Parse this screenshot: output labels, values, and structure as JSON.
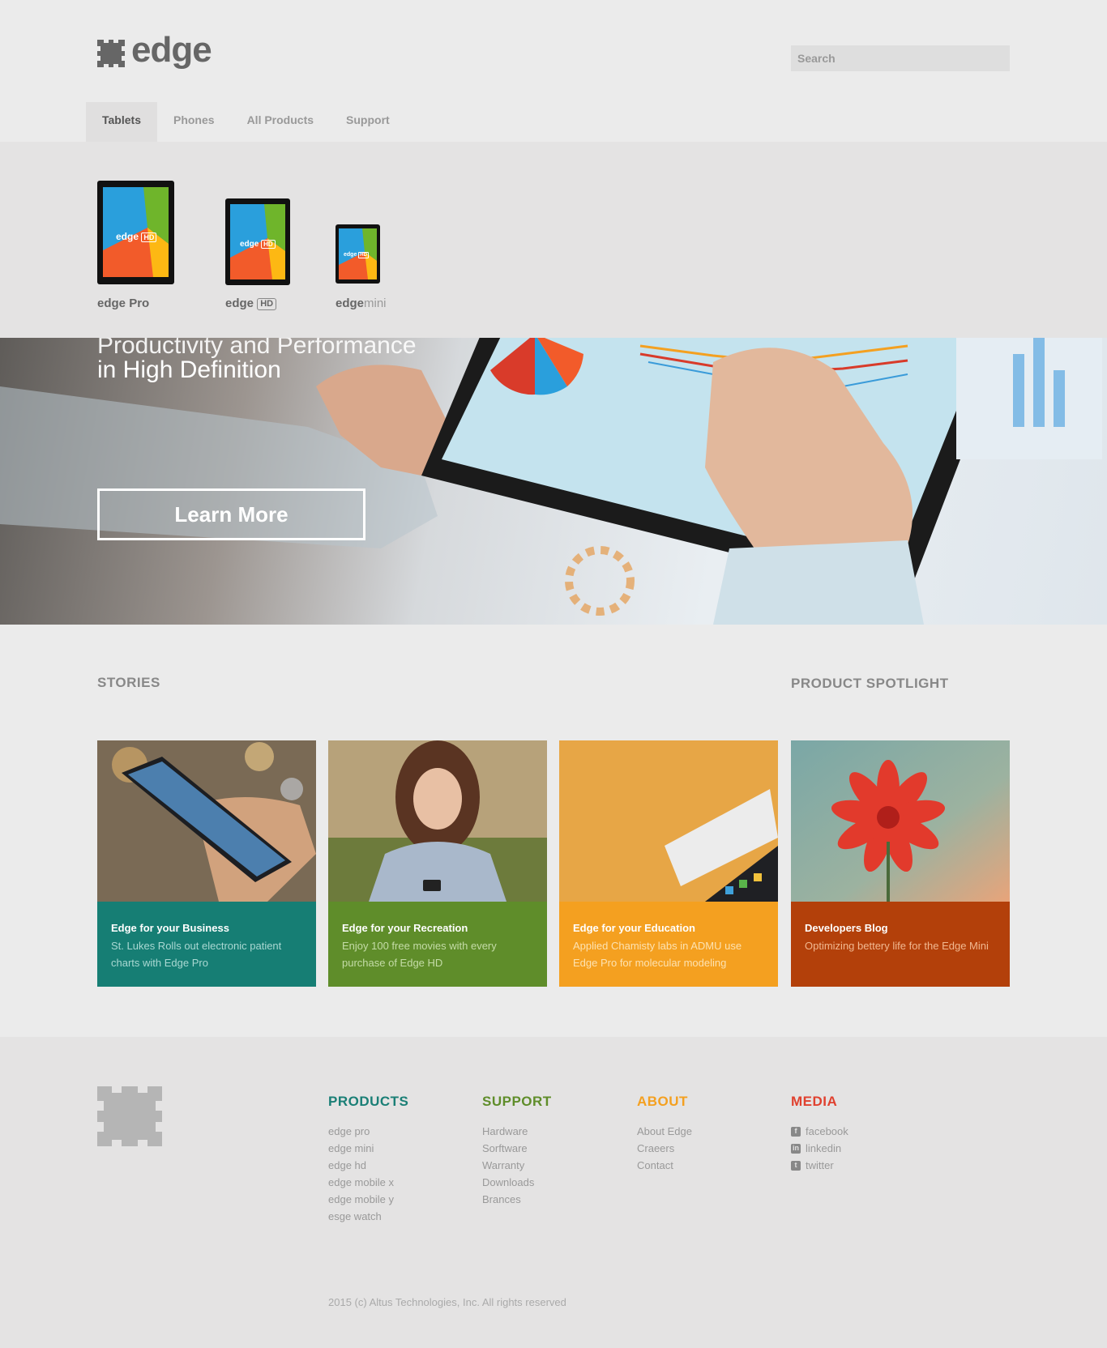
{
  "brand": {
    "name": "edge"
  },
  "search": {
    "placeholder": "Search"
  },
  "nav": {
    "tabs": [
      "Tablets",
      "Phones",
      "All Products",
      "Support"
    ],
    "active": "Tablets"
  },
  "products": [
    {
      "label": "edge",
      "suffix": "Pro",
      "screen_text": "edge",
      "screen_badge": "HD"
    },
    {
      "label": "edge",
      "suffix": "HD",
      "screen_text": "edge",
      "screen_badge": "HD"
    },
    {
      "label": "edge",
      "suffix": "mini",
      "screen_text": "edge",
      "screen_badge": "HD"
    }
  ],
  "hero": {
    "line1": "Productivity and Performance",
    "line2": "in High Definition",
    "cta": "Learn More"
  },
  "sections": {
    "stories": "STORIES",
    "spotlight": "PRODUCT SPOTLIGHT"
  },
  "cards": [
    {
      "title": "Edge for your Business",
      "desc": "St. Lukes Rolls out electronic patient charts with Edge Pro",
      "color": "#167e74",
      "desc_color": "#a9d8d2"
    },
    {
      "title": "Edge for your Recreation",
      "desc": "Enjoy 100 free movies with every purchase of Edge HD",
      "color": "#5f8d2a",
      "desc_color": "#c4dca7"
    },
    {
      "title": "Edge for your Education",
      "desc": "Applied Chamisty labs in ADMU use Edge Pro for molecular modeling",
      "color": "#f4a020",
      "desc_color": "#fde2b1"
    },
    {
      "title": "Developers Blog",
      "desc": "Optimizing bettery life for the Edge Mini",
      "color": "#b3400a",
      "desc_color": "#f1b890"
    }
  ],
  "footer": {
    "products": {
      "title": "PRODUCTS",
      "color": "#1a7f76",
      "items": [
        "edge pro",
        "edge mini",
        "edge hd",
        "edge mobile x",
        "edge mobile y",
        "esge watch"
      ]
    },
    "support": {
      "title": "SUPPORT",
      "color": "#5f8d2a",
      "items": [
        "Hardware",
        "Sorftware",
        "Warranty",
        "Downloads",
        "Brances"
      ]
    },
    "about": {
      "title": "ABOUT",
      "color": "#f4a020",
      "items": [
        "About Edge",
        "Craeers",
        "Contact"
      ]
    },
    "media": {
      "title": "MEDIA",
      "color": "#e0412f",
      "items": [
        "facebook",
        "linkedin",
        "twitter"
      ]
    },
    "copyright": "2015 (c) Altus Technologies, Inc. All rights reserved"
  }
}
